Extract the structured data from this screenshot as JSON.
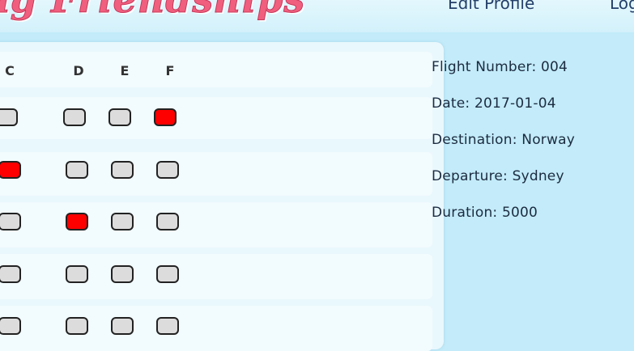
{
  "header": {
    "logo_text": "Flying Friendships",
    "nav": {
      "edit_profile": "Edit Profile",
      "logout": "Logout"
    }
  },
  "seat_map": {
    "columns": [
      "C",
      "D",
      "E",
      "F"
    ],
    "rows": [
      {
        "C": "available",
        "D": "available",
        "E": "available",
        "F": "taken"
      },
      {
        "C": "taken",
        "D": "available",
        "E": "available",
        "F": "available"
      },
      {
        "C": "available",
        "D": "taken",
        "E": "available",
        "F": "available"
      },
      {
        "C": "available",
        "D": "available",
        "E": "available",
        "F": "available"
      },
      {
        "C": "available",
        "D": "available",
        "E": "available",
        "F": "available"
      }
    ]
  },
  "flight_info": {
    "number": "Flight Number: 004",
    "date": "Date: 2017-01-04",
    "destination": "Destination: Norway",
    "departure": "Departure: Sydney",
    "duration": "Duration: 5000"
  },
  "colors": {
    "taken": "#ff0000",
    "available": "#dcdcdc",
    "logo": "#f0607e"
  }
}
